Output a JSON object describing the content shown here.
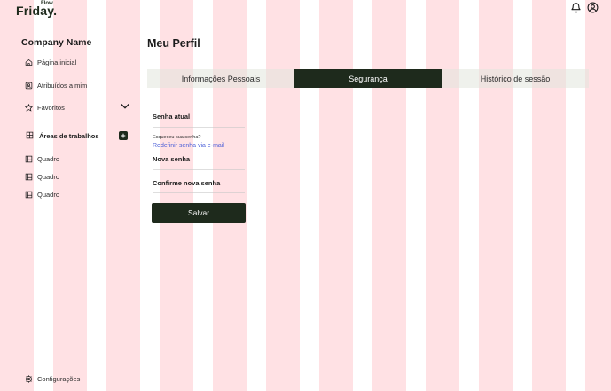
{
  "logo": {
    "main": "Friday.",
    "flow": "Flow"
  },
  "header": {
    "icons": [
      "bell-icon",
      "user-circle-icon"
    ]
  },
  "sidebar": {
    "company": "Company Name",
    "items": [
      {
        "label": "Página inicial",
        "icon": "home-icon"
      },
      {
        "label": "Atribuídos a mim",
        "icon": "user-card-icon"
      },
      {
        "label": "Favoritos",
        "icon": "star-icon"
      }
    ],
    "workspace": {
      "label": "Áreas de trabalhos",
      "add": "+"
    },
    "boards": [
      {
        "label": "Quadro"
      },
      {
        "label": "Quadro"
      },
      {
        "label": "Quadro"
      }
    ],
    "settings": "Configurações"
  },
  "main": {
    "title": "Meu Perfil",
    "tabs": [
      {
        "label": "Informações Pessoais",
        "active": false
      },
      {
        "label": "Segurança",
        "active": true
      },
      {
        "label": "Histórico de sessão",
        "active": false
      }
    ],
    "form": {
      "current_password_label": "Senha atual",
      "forgot_text": "Esqueceu sua senha?",
      "reset_link": "Redefinir senha via e-mail",
      "new_password_label": "Nova senha",
      "confirm_password_label": "Confirme nova senha",
      "save_label": "Salvar"
    }
  },
  "colors": {
    "accent": "#1e2a1c",
    "stripe": "#ffe1e4",
    "link": "#4b5fd8"
  }
}
